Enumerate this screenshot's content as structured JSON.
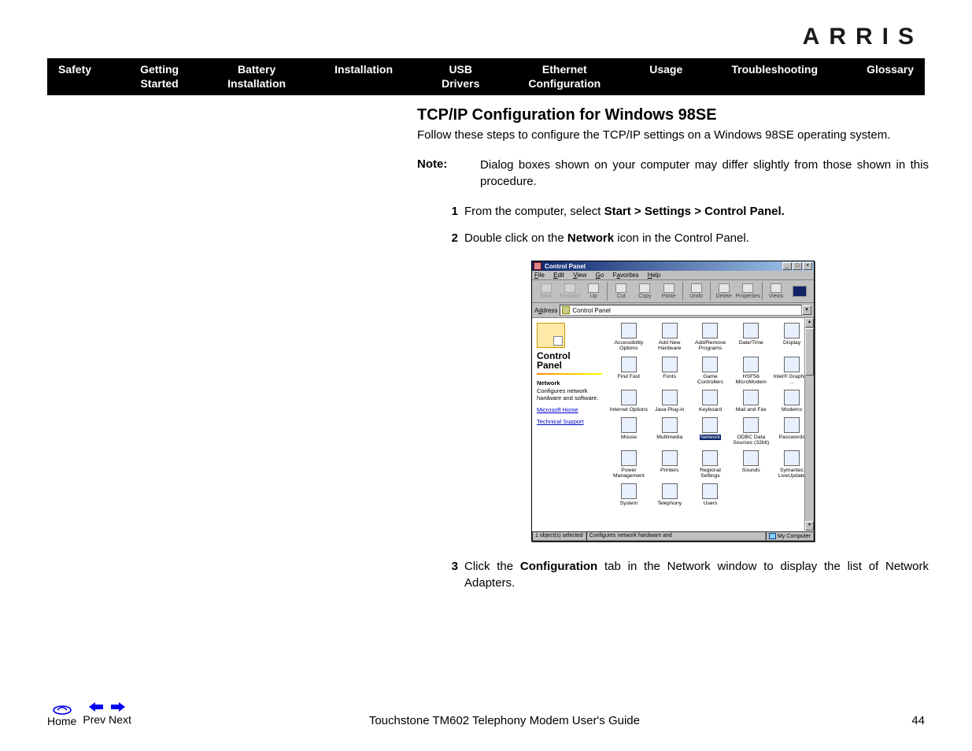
{
  "brand": "ARRIS",
  "nav": [
    "Safety",
    "Getting\nStarted",
    "Battery\nInstallation",
    "Installation",
    "USB\nDrivers",
    "Ethernet\nConfiguration",
    "Usage",
    "Troubleshooting",
    "Glossary"
  ],
  "title": "TCP/IP Configuration for Windows 98SE",
  "intro": "Follow these steps to configure the TCP/IP settings on a Windows 98SE operating system.",
  "note_label": "Note:",
  "note_text": "Dialog boxes shown on your computer may differ slightly from those shown in this procedure.",
  "steps": {
    "s1_num": "1",
    "s1_a": "From the computer, select ",
    "s1_b": "Start > Settings > Control Panel.",
    "s2_num": "2",
    "s2_a": "Double click on the ",
    "s2_b": "Network",
    "s2_c": " icon in the Control Panel.",
    "s3_num": "3",
    "s3_a": "Click the ",
    "s3_b": "Configuration",
    "s3_c": " tab in the Network window to display the list of Network Adapters."
  },
  "cp": {
    "window_title": "Control Panel",
    "menus": [
      "File",
      "Edit",
      "View",
      "Go",
      "Favorites",
      "Help"
    ],
    "tools": [
      {
        "label": "Back",
        "disabled": true
      },
      {
        "label": "Forward",
        "disabled": true
      },
      {
        "label": "Up"
      },
      {
        "sep": true
      },
      {
        "label": "Cut"
      },
      {
        "label": "Copy"
      },
      {
        "label": "Paste"
      },
      {
        "sep": true
      },
      {
        "label": "Undo"
      },
      {
        "sep": true
      },
      {
        "label": "Delete"
      },
      {
        "label": "Properties"
      },
      {
        "sep": true
      },
      {
        "label": "Views"
      }
    ],
    "address_label": "Address",
    "address_value": "Control Panel",
    "side_title": "Control Panel",
    "side_sub_label": "Network",
    "side_sub_text": "Configures network hardware and software.",
    "side_links": [
      "Microsoft Home",
      "Technical Support"
    ],
    "icons": [
      "Accessibility Options",
      "Add New Hardware",
      "Add/Remove Programs",
      "Date/Time",
      "Display",
      "Find Fast",
      "Fonts",
      "Game Controllers",
      "HSF56 MicroModem",
      "Intel® Graphics ...",
      "Internet Options",
      "Java Plug-in",
      "Keyboard",
      "Mail and Fax",
      "Modems",
      "Mouse",
      "Multimedia",
      "Network",
      "ODBC Data Sources (32bit)",
      "Passwords",
      "Power Management",
      "Printers",
      "Regional Settings",
      "Sounds",
      "Symantec LiveUpdate",
      "System",
      "Telephony",
      "Users"
    ],
    "selected_index": 17,
    "status_left": "1 object(s) selected",
    "status_mid": "Configures network hardware and",
    "status_right": "My Computer"
  },
  "footer": {
    "home": "Home",
    "prev": "Prev",
    "next": "Next",
    "center": "Touchstone TM602 Telephony Modem User's Guide",
    "page": "44"
  }
}
